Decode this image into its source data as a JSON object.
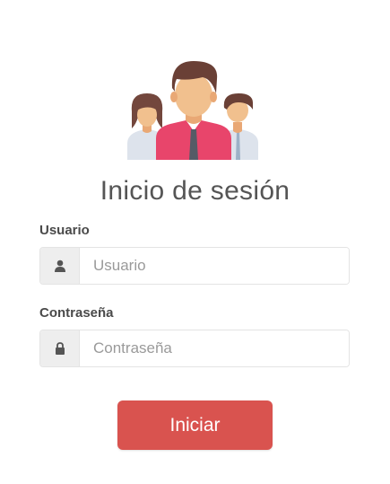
{
  "header": {
    "icon": "users-group-icon",
    "title": "Inicio de sesión"
  },
  "form": {
    "username": {
      "label": "Usuario",
      "placeholder": "Usuario",
      "value": "",
      "icon": "user-icon"
    },
    "password": {
      "label": "Contraseña",
      "placeholder": "Contraseña",
      "value": "",
      "icon": "lock-icon"
    },
    "submit_label": "Iniciar"
  },
  "colors": {
    "accent": "#d9534f",
    "addon_bg": "#eeeeee",
    "text": "#555555"
  }
}
